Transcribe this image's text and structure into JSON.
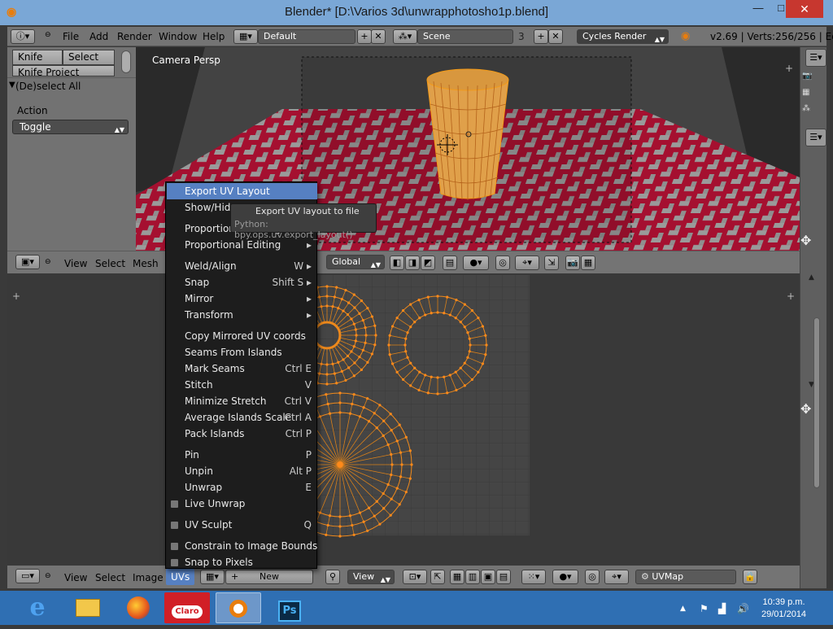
{
  "window": {
    "title": "Blender* [D:\\Varios 3d\\unwrapphotosho1p.blend]",
    "minimize": "—",
    "maximize": "□",
    "close": "✕"
  },
  "info": {
    "menus": [
      "File",
      "Add",
      "Render",
      "Window",
      "Help"
    ],
    "layout": "Default",
    "scene": "Scene",
    "scene_users": "3",
    "engine": "Cycles Render",
    "stats": "v2.69 | Verts:256/256 | Edges"
  },
  "toolpanel": {
    "tab_knife": "Knife",
    "tab_select": "Select",
    "tab_knife_project": "Knife Project",
    "operator_title": "(De)select All",
    "action_label": "Action",
    "action_value": "Toggle"
  },
  "view3d": {
    "label": "Camera Persp",
    "menus": [
      "View",
      "Select",
      "Mesh"
    ],
    "orientation": "Global"
  },
  "uv_header": {
    "menus": [
      "View",
      "Select",
      "Image",
      "UVs"
    ],
    "new_label": "New",
    "view_label": "View",
    "uvmap": "UVMap"
  },
  "uvs_menu": {
    "items": [
      {
        "label": "Export UV Layout",
        "shortcut": "",
        "highlighted": true
      },
      {
        "label": "Show/Hide Faces",
        "shortcut": ""
      },
      {
        "label": "Proportional Editing Falloff",
        "shortcut": ""
      },
      {
        "label": "Proportional Editing",
        "shortcut": "▸"
      },
      {
        "label": "Weld/Align",
        "shortcut": "W ▸"
      },
      {
        "label": "Snap",
        "shortcut": "Shift S ▸"
      },
      {
        "label": "Mirror",
        "shortcut": "▸"
      },
      {
        "label": "Transform",
        "shortcut": "▸"
      },
      {
        "label": "Copy Mirrored UV coords",
        "shortcut": ""
      },
      {
        "label": "Seams From Islands",
        "shortcut": ""
      },
      {
        "label": "Mark Seams",
        "shortcut": "Ctrl E"
      },
      {
        "label": "Stitch",
        "shortcut": "V"
      },
      {
        "label": "Minimize Stretch",
        "shortcut": "Ctrl V"
      },
      {
        "label": "Average Islands Scale",
        "shortcut": "Ctrl A"
      },
      {
        "label": "Pack Islands",
        "shortcut": "Ctrl P"
      },
      {
        "label": "Pin",
        "shortcut": "P"
      },
      {
        "label": "Unpin",
        "shortcut": "Alt P"
      },
      {
        "label": "Unwrap",
        "shortcut": "E"
      },
      {
        "label": "Live Unwrap",
        "shortcut": "",
        "checkbox": true
      },
      {
        "label": "UV Sculpt",
        "shortcut": "Q",
        "checkbox": true
      },
      {
        "label": "Constrain to Image Bounds",
        "shortcut": "",
        "checkbox": true
      },
      {
        "label": "Snap to Pixels",
        "shortcut": "",
        "checkbox": true
      }
    ]
  },
  "tooltip": {
    "title": "Export UV layout to file",
    "python": "Python: bpy.ops.uv.export_layout()"
  },
  "taskbar": {
    "apps": [
      "internet-explorer",
      "file-explorer",
      "firefox",
      "claro",
      "blender",
      "photoshop"
    ],
    "claro_label": "Claro",
    "ps_label": "Ps",
    "time": "10:39 p.m.",
    "date": "29/01/2014"
  },
  "colors": {
    "menu_bg": "#1d1d1d",
    "menu_highlight": "#5680c2",
    "uv_wire": "#f08a1c",
    "floor_red": "#b0102c",
    "taskbar": "#2f6fb3",
    "titlebar": "#7aa7d6"
  }
}
